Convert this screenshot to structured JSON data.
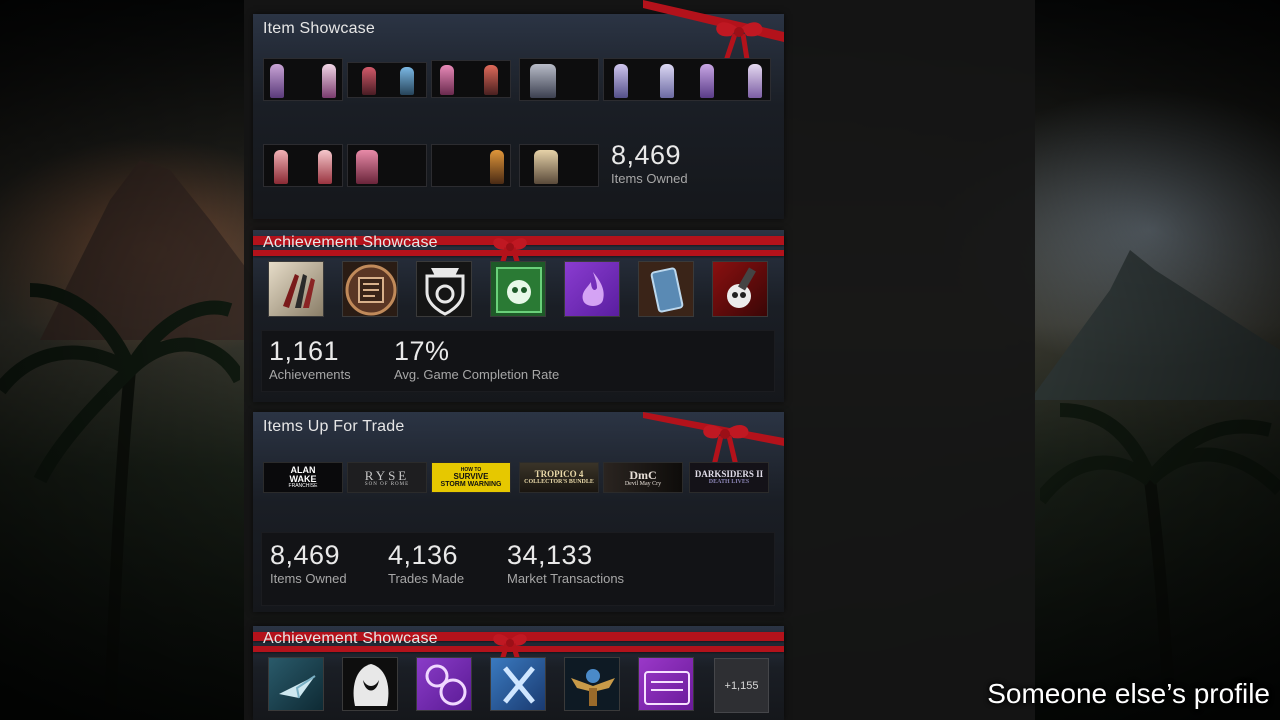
{
  "item_showcase": {
    "title": "Item Showcase",
    "items": [
      "item-1",
      "item-2",
      "item-3",
      "item-4",
      "item-5",
      "item-6",
      "item-7",
      "item-8",
      "item-9",
      "item-10"
    ],
    "items_owned_value": "8,469",
    "items_owned_label": "Items Owned"
  },
  "achievement_showcase_1": {
    "title": "Achievement Showcase",
    "icons": [
      "bullets-icon",
      "book-icon",
      "shield-crest-icon",
      "green-creature-icon",
      "purple-flame-icon",
      "blue-phone-icon",
      "skull-hammer-icon"
    ],
    "achievements_value": "1,161",
    "achievements_label": "Achievements",
    "completion_value": "17%",
    "completion_label": "Avg. Game Completion Rate"
  },
  "items_up_for_trade": {
    "title": "Items Up For Trade",
    "games": [
      {
        "line1": "ALAN",
        "line2": "WAKE",
        "line3": "FRANCHISE"
      },
      {
        "line1": "RYSE",
        "line2": "SON OF ROME",
        "line3": ""
      },
      {
        "line1": "HOW TO",
        "line2": "SURVIVE",
        "line3": "STORM WARNING"
      },
      {
        "line1": "TROPICO 4",
        "line2": "COLLECTOR'S BUNDLE",
        "line3": ""
      },
      {
        "line1": "DmC",
        "line2": "Devil May Cry",
        "line3": ""
      },
      {
        "line1": "DARKSIDERS II",
        "line2": "DEATH LIVES",
        "line3": ""
      }
    ],
    "items_owned_value": "8,469",
    "items_owned_label": "Items Owned",
    "trades_value": "4,136",
    "trades_label": "Trades Made",
    "market_value": "34,133",
    "market_label": "Market Transactions"
  },
  "achievement_showcase_2": {
    "title": "Achievement Showcase",
    "icons": [
      "paper-plane-icon",
      "hooded-figure-icon",
      "rings-icon",
      "blue-x-icon",
      "winged-emblem-icon",
      "genki-bowl-icon"
    ],
    "more_label": "+1,155"
  },
  "caption": "Someone else’s profile",
  "colors": {
    "ribbon": "#b3121b",
    "panel": "#1a1e25",
    "column": "#161616"
  }
}
